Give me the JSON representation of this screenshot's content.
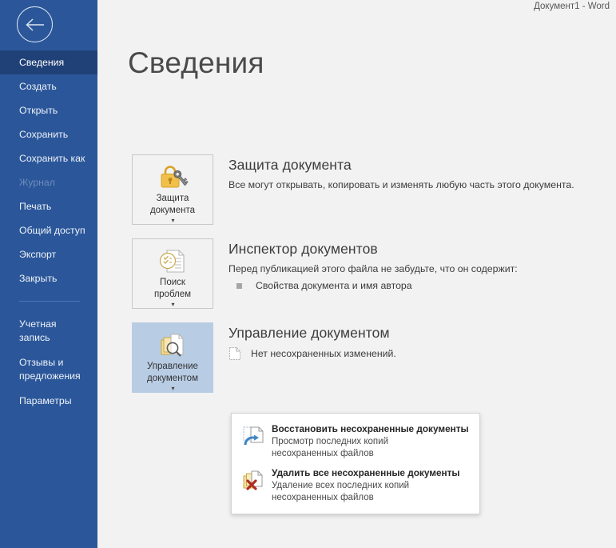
{
  "titlebar": {
    "document_title": "Документ1  -  Word"
  },
  "sidebar": {
    "back_icon": "back-arrow-icon",
    "items": [
      {
        "label": "Сведения",
        "state": "active"
      },
      {
        "label": "Создать",
        "state": "normal"
      },
      {
        "label": "Открыть",
        "state": "normal"
      },
      {
        "label": "Сохранить",
        "state": "normal"
      },
      {
        "label": "Сохранить как",
        "state": "normal"
      },
      {
        "label": "Журнал",
        "state": "disabled"
      },
      {
        "label": "Печать",
        "state": "normal"
      },
      {
        "label": "Общий доступ",
        "state": "normal"
      },
      {
        "label": "Экспорт",
        "state": "normal"
      },
      {
        "label": "Закрыть",
        "state": "normal"
      }
    ],
    "items_bottom": [
      {
        "label": "Учетная\nзапись",
        "state": "normal"
      },
      {
        "label": "Отзывы и\nпредложения",
        "state": "normal"
      },
      {
        "label": "Параметры",
        "state": "normal"
      }
    ]
  },
  "main": {
    "page_title": "Сведения",
    "sections": [
      {
        "tile_label": "Защита\nдокумента",
        "tile_icon": "lock-key-icon",
        "tile_caret": "▾",
        "title": "Защита документа",
        "description": "Все могут открывать, копировать и изменять любую часть этого документа.",
        "highlighted": false
      },
      {
        "tile_label": "Поиск\nпроблем",
        "tile_icon": "document-checklist-icon",
        "tile_caret": "▾",
        "title": "Инспектор документов",
        "description": "Перед публикацией этого файла не забудьте, что он содержит:",
        "bullet": "Свойства документа и имя автора",
        "highlighted": false
      },
      {
        "tile_label": "Управление\nдокументом",
        "tile_icon": "document-search-icon",
        "tile_caret": "▾",
        "title": "Управление документом",
        "row_icon": "document-icon",
        "row_text": "Нет несохраненных изменений.",
        "highlighted": true
      }
    ]
  },
  "dropdown": {
    "items": [
      {
        "icon": "recover-document-icon",
        "title": "Восстановить несохраненные документы",
        "subtitle": "Просмотр последних копий\nнесохраненных файлов"
      },
      {
        "icon": "delete-documents-icon",
        "title": "Удалить все несохраненные документы",
        "subtitle": "Удаление всех последних копий\nнесохраненных файлов"
      }
    ]
  },
  "colors": {
    "sidebar_blue": "#2b579a",
    "sidebar_active": "#204177",
    "content_bg": "#f2f2f2",
    "tile_highlight": "#b8cce4",
    "lock_gold": "#e8b33c",
    "accent_red": "#c0392b"
  }
}
